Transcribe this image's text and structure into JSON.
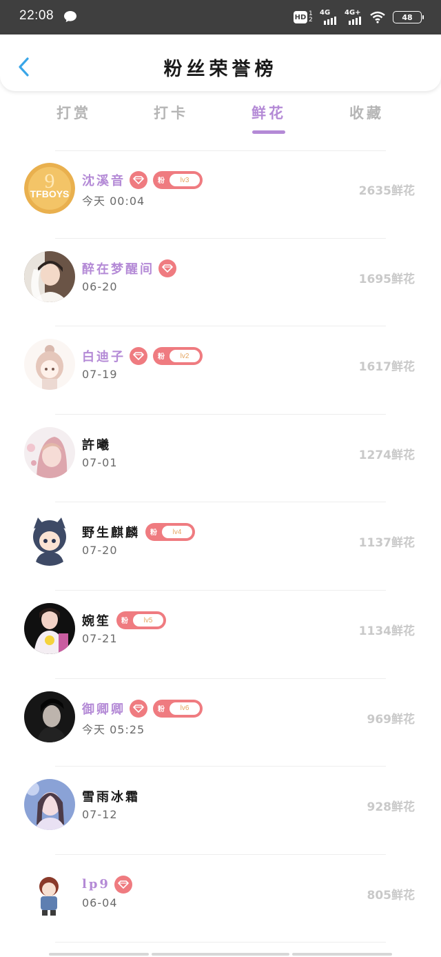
{
  "status_bar": {
    "time": "22:08",
    "icons": [
      "message-icon",
      "hd-icon",
      "signal-4g-icon",
      "signal-4g-plus-icon",
      "wifi-icon",
      "battery-icon"
    ],
    "hd": "HD",
    "hd_sub": "1 2",
    "sig1": "4G",
    "sig2": "4G+",
    "battery": "48"
  },
  "header": {
    "title": "粉丝荣誉榜",
    "back_icon": "chevron-left-icon"
  },
  "tabs": [
    {
      "label": "打赏"
    },
    {
      "label": "打卡"
    },
    {
      "label": "鲜花"
    },
    {
      "label": "收藏"
    }
  ],
  "active_tab": 2,
  "colors": {
    "accent": "#b48ad6",
    "badge": "#ef7b80",
    "level_text": "#e4a45e",
    "score": "#c9c9c9"
  },
  "badge_prefix": "粉",
  "rows": [
    {
      "name": "沈溪音",
      "vip": true,
      "diamond": true,
      "level": "lv3",
      "date": "今天  00:04",
      "score": "2635鲜花"
    },
    {
      "name": "醉在梦醒间",
      "vip": true,
      "diamond": true,
      "level": "",
      "date": "06-20",
      "score": "1695鲜花"
    },
    {
      "name": "白迪子",
      "vip": true,
      "diamond": true,
      "level": "lv2",
      "date": "07-19",
      "score": "1617鲜花"
    },
    {
      "name": "許曦",
      "vip": false,
      "diamond": false,
      "level": "",
      "date": "07-01",
      "score": "1274鲜花"
    },
    {
      "name": "野生麒麟",
      "vip": false,
      "diamond": false,
      "level": "lv4",
      "date": "07-20",
      "score": "1137鲜花"
    },
    {
      "name": "婉笙",
      "vip": false,
      "diamond": false,
      "level": "lv5",
      "date": "07-21",
      "score": "1134鲜花"
    },
    {
      "name": "御卿卿",
      "vip": true,
      "diamond": true,
      "level": "lv6",
      "date": "今天  05:25",
      "score": "969鲜花"
    },
    {
      "name": "雪雨冰霜",
      "vip": false,
      "diamond": false,
      "level": "",
      "date": "07-12",
      "score": "928鲜花"
    },
    {
      "name": "lp9",
      "vip": true,
      "diamond": true,
      "level": "",
      "date": "06-04",
      "score": "805鲜花"
    }
  ],
  "avatar_text": {
    "tfboys": "TFBOYS",
    "nine": "9"
  }
}
